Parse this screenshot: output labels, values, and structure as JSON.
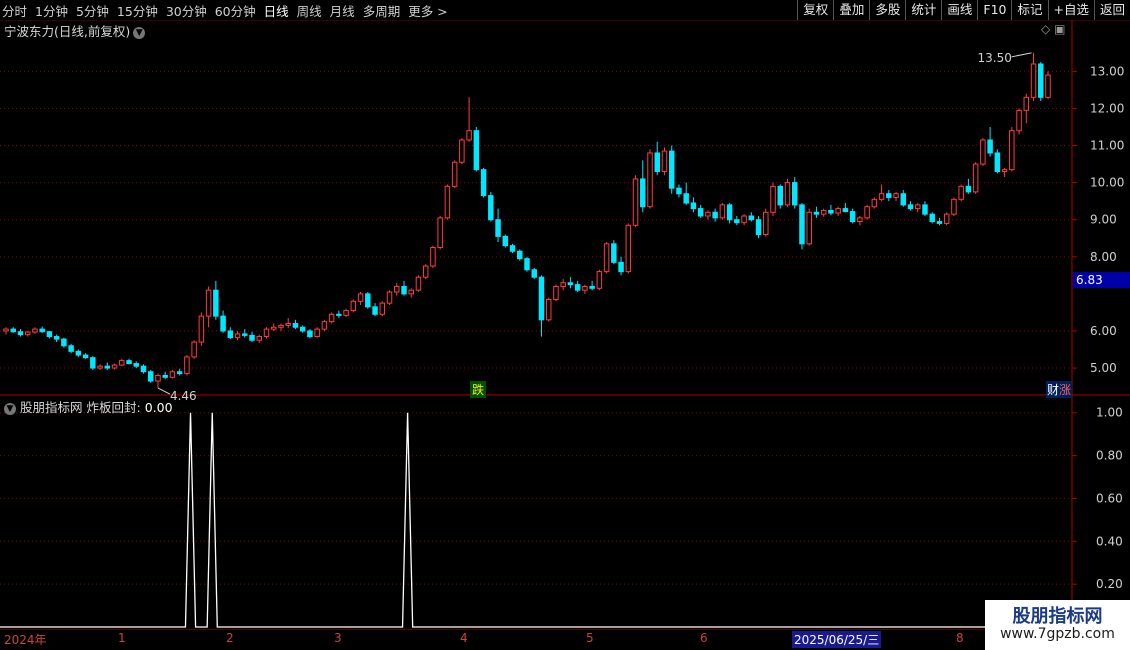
{
  "toolbar": {
    "periods": [
      "分时",
      "1分钟",
      "5分钟",
      "15分钟",
      "30分钟",
      "60分钟",
      "日线",
      "周线",
      "月线",
      "多周期",
      "更多 >"
    ],
    "active_period": "日线",
    "actions": [
      "复权",
      "叠加",
      "多股",
      "统计",
      "画线",
      "F10",
      "标记",
      "+自选",
      "返回"
    ]
  },
  "chart": {
    "title": "宁波东力(日线,前复权)",
    "high_label": "13.50",
    "low_label": "4.46",
    "current_price": "6.83",
    "y_ticks": [
      "13.00",
      "12.00",
      "11.00",
      "10.00",
      "9.00",
      "8.00",
      "6.00",
      "5.00"
    ],
    "tag_die": "跌",
    "tag_cai": "财",
    "tag_zhang": "涨",
    "colors": {
      "up": "#ff3c3c",
      "down": "#00e8ff",
      "grid": "#8a0000",
      "axis": "#b00000"
    }
  },
  "indicator": {
    "name": "股朋指标网",
    "series_label": "炸板回封:",
    "value": "0.00",
    "y_ticks": [
      "1.00",
      "0.80",
      "0.60",
      "0.40",
      "0.20"
    ]
  },
  "date_axis": {
    "labels": [
      "2024年",
      "1",
      "2",
      "3",
      "4",
      "5",
      "6",
      "2025/06/25/三",
      "8"
    ]
  },
  "watermark": {
    "line1": "股朋指标网",
    "line2": "www.7gpzb.com"
  },
  "chart_data": {
    "type": "candlestick",
    "ylim": [
      4.3,
      13.9
    ],
    "candles": [
      [
        6.0,
        6.1,
        5.9,
        6.05
      ],
      [
        6.05,
        6.1,
        5.95,
        5.98
      ],
      [
        5.98,
        6.05,
        5.85,
        5.9
      ],
      [
        5.9,
        6.0,
        5.85,
        5.97
      ],
      [
        5.97,
        6.1,
        5.92,
        6.05
      ],
      [
        6.05,
        6.12,
        5.95,
        5.98
      ],
      [
        5.98,
        6.0,
        5.8,
        5.85
      ],
      [
        5.85,
        5.9,
        5.7,
        5.78
      ],
      [
        5.78,
        5.82,
        5.55,
        5.6
      ],
      [
        5.6,
        5.65,
        5.4,
        5.45
      ],
      [
        5.45,
        5.5,
        5.3,
        5.35
      ],
      [
        5.35,
        5.4,
        5.25,
        5.28
      ],
      [
        5.28,
        5.32,
        4.95,
        5.0
      ],
      [
        5.0,
        5.1,
        4.95,
        5.05
      ],
      [
        5.05,
        5.15,
        4.95,
        5.0
      ],
      [
        5.0,
        5.12,
        4.96,
        5.08
      ],
      [
        5.08,
        5.25,
        5.05,
        5.2
      ],
      [
        5.2,
        5.25,
        5.1,
        5.12
      ],
      [
        5.12,
        5.18,
        5.0,
        5.05
      ],
      [
        5.05,
        5.1,
        4.85,
        4.9
      ],
      [
        4.9,
        4.95,
        4.6,
        4.65
      ],
      [
        4.65,
        4.85,
        4.46,
        4.8
      ],
      [
        4.8,
        4.9,
        4.7,
        4.75
      ],
      [
        4.75,
        4.95,
        4.72,
        4.9
      ],
      [
        4.9,
        4.98,
        4.8,
        4.85
      ],
      [
        4.85,
        5.35,
        4.8,
        5.3
      ],
      [
        5.3,
        5.75,
        5.25,
        5.7
      ],
      [
        5.7,
        6.5,
        5.6,
        6.4
      ],
      [
        6.4,
        7.2,
        6.1,
        7.1
      ],
      [
        7.1,
        7.35,
        6.3,
        6.4
      ],
      [
        6.4,
        6.55,
        5.95,
        6.0
      ],
      [
        6.0,
        6.1,
        5.78,
        5.82
      ],
      [
        5.82,
        6.0,
        5.75,
        5.92
      ],
      [
        5.92,
        6.05,
        5.82,
        5.88
      ],
      [
        5.88,
        5.98,
        5.7,
        5.75
      ],
      [
        5.75,
        5.9,
        5.68,
        5.85
      ],
      [
        5.85,
        6.1,
        5.8,
        6.05
      ],
      [
        6.05,
        6.2,
        6.0,
        6.1
      ],
      [
        6.1,
        6.2,
        6.0,
        6.15
      ],
      [
        6.15,
        6.35,
        6.08,
        6.2
      ],
      [
        6.2,
        6.3,
        6.05,
        6.1
      ],
      [
        6.1,
        6.15,
        5.95,
        6.0
      ],
      [
        6.0,
        6.05,
        5.8,
        5.85
      ],
      [
        5.85,
        6.1,
        5.82,
        6.05
      ],
      [
        6.05,
        6.3,
        6.0,
        6.25
      ],
      [
        6.25,
        6.5,
        6.2,
        6.45
      ],
      [
        6.45,
        6.55,
        6.35,
        6.42
      ],
      [
        6.42,
        6.6,
        6.38,
        6.55
      ],
      [
        6.55,
        6.85,
        6.5,
        6.8
      ],
      [
        6.8,
        7.05,
        6.7,
        7.0
      ],
      [
        7.0,
        7.05,
        6.6,
        6.65
      ],
      [
        6.65,
        6.75,
        6.4,
        6.45
      ],
      [
        6.45,
        6.8,
        6.4,
        6.75
      ],
      [
        6.75,
        7.1,
        6.7,
        7.05
      ],
      [
        7.05,
        7.3,
        6.95,
        7.2
      ],
      [
        7.2,
        7.35,
        6.95,
        7.0
      ],
      [
        7.0,
        7.15,
        6.9,
        7.1
      ],
      [
        7.1,
        7.5,
        7.05,
        7.45
      ],
      [
        7.45,
        7.8,
        7.4,
        7.75
      ],
      [
        7.75,
        8.3,
        7.7,
        8.25
      ],
      [
        8.25,
        9.1,
        8.2,
        9.05
      ],
      [
        9.05,
        9.95,
        9.0,
        9.9
      ],
      [
        9.9,
        10.6,
        9.85,
        10.55
      ],
      [
        10.55,
        11.2,
        10.5,
        11.15
      ],
      [
        11.15,
        12.3,
        11.1,
        11.4
      ],
      [
        11.4,
        11.5,
        10.3,
        10.35
      ],
      [
        10.35,
        10.4,
        9.6,
        9.65
      ],
      [
        9.65,
        9.75,
        8.95,
        9.0
      ],
      [
        9.0,
        9.3,
        8.4,
        8.55
      ],
      [
        8.55,
        8.6,
        8.25,
        8.3
      ],
      [
        8.3,
        8.35,
        8.1,
        8.15
      ],
      [
        8.15,
        8.2,
        7.9,
        7.95
      ],
      [
        7.95,
        8.0,
        7.6,
        7.65
      ],
      [
        7.65,
        7.7,
        7.4,
        7.45
      ],
      [
        7.45,
        7.5,
        5.85,
        6.3
      ],
      [
        6.3,
        6.9,
        6.25,
        6.85
      ],
      [
        6.85,
        7.25,
        6.8,
        7.2
      ],
      [
        7.2,
        7.4,
        7.1,
        7.3
      ],
      [
        7.3,
        7.45,
        7.15,
        7.25
      ],
      [
        7.25,
        7.35,
        7.05,
        7.1
      ],
      [
        7.1,
        7.25,
        7.0,
        7.2
      ],
      [
        7.2,
        7.35,
        7.1,
        7.15
      ],
      [
        7.15,
        7.65,
        7.1,
        7.6
      ],
      [
        7.6,
        8.4,
        7.55,
        8.35
      ],
      [
        8.35,
        8.45,
        7.8,
        7.85
      ],
      [
        7.85,
        8.0,
        7.5,
        7.6
      ],
      [
        7.6,
        8.9,
        7.55,
        8.85
      ],
      [
        8.85,
        10.2,
        8.8,
        10.1
      ],
      [
        10.1,
        10.6,
        9.2,
        9.35
      ],
      [
        9.35,
        10.9,
        9.3,
        10.8
      ],
      [
        10.8,
        11.1,
        10.2,
        10.3
      ],
      [
        10.3,
        10.95,
        10.2,
        10.85
      ],
      [
        10.85,
        11.0,
        9.7,
        9.85
      ],
      [
        9.85,
        9.95,
        9.6,
        9.7
      ],
      [
        9.7,
        10.0,
        9.4,
        9.45
      ],
      [
        9.45,
        9.6,
        9.2,
        9.3
      ],
      [
        9.3,
        9.4,
        9.05,
        9.1
      ],
      [
        9.1,
        9.25,
        9.0,
        9.2
      ],
      [
        9.2,
        9.3,
        8.95,
        9.05
      ],
      [
        9.05,
        9.45,
        9.0,
        9.4
      ],
      [
        9.4,
        9.45,
        8.9,
        9.0
      ],
      [
        9.0,
        9.1,
        8.85,
        8.92
      ],
      [
        8.92,
        9.15,
        8.85,
        9.1
      ],
      [
        9.1,
        9.2,
        8.95,
        9.0
      ],
      [
        9.0,
        9.1,
        8.5,
        8.6
      ],
      [
        8.6,
        9.3,
        8.55,
        9.2
      ],
      [
        9.2,
        10.0,
        9.1,
        9.9
      ],
      [
        9.9,
        9.95,
        9.3,
        9.4
      ],
      [
        9.4,
        10.1,
        9.35,
        10.0
      ],
      [
        10.0,
        10.15,
        9.3,
        9.4
      ],
      [
        9.4,
        9.45,
        8.2,
        8.35
      ],
      [
        8.35,
        9.3,
        8.3,
        9.2
      ],
      [
        9.2,
        9.35,
        9.05,
        9.15
      ],
      [
        9.15,
        9.3,
        9.08,
        9.25
      ],
      [
        9.25,
        9.4,
        9.12,
        9.18
      ],
      [
        9.18,
        9.35,
        9.1,
        9.3
      ],
      [
        9.3,
        9.45,
        9.2,
        9.22
      ],
      [
        9.22,
        9.3,
        8.9,
        8.95
      ],
      [
        8.95,
        9.1,
        8.85,
        9.05
      ],
      [
        9.05,
        9.4,
        9.0,
        9.35
      ],
      [
        9.35,
        9.6,
        9.3,
        9.55
      ],
      [
        9.55,
        9.95,
        9.5,
        9.7
      ],
      [
        9.7,
        9.8,
        9.5,
        9.6
      ],
      [
        9.6,
        9.75,
        9.5,
        9.7
      ],
      [
        9.7,
        9.8,
        9.35,
        9.4
      ],
      [
        9.4,
        9.5,
        9.25,
        9.3
      ],
      [
        9.3,
        9.45,
        9.2,
        9.4
      ],
      [
        9.4,
        9.5,
        9.1,
        9.15
      ],
      [
        9.15,
        9.2,
        8.9,
        8.95
      ],
      [
        8.95,
        9.05,
        8.85,
        8.9
      ],
      [
        8.9,
        9.2,
        8.85,
        9.15
      ],
      [
        9.15,
        9.6,
        9.1,
        9.55
      ],
      [
        9.55,
        9.95,
        9.5,
        9.9
      ],
      [
        9.9,
        10.1,
        9.7,
        9.75
      ],
      [
        9.75,
        10.55,
        9.7,
        10.5
      ],
      [
        10.5,
        11.2,
        10.45,
        11.15
      ],
      [
        11.15,
        11.5,
        10.7,
        10.8
      ],
      [
        10.8,
        10.9,
        10.25,
        10.3
      ],
      [
        10.3,
        10.4,
        10.15,
        10.35
      ],
      [
        10.35,
        11.5,
        10.3,
        11.4
      ],
      [
        11.4,
        12.0,
        11.3,
        11.95
      ],
      [
        11.95,
        12.4,
        11.6,
        12.3
      ],
      [
        12.3,
        13.5,
        12.2,
        13.2
      ],
      [
        13.2,
        13.25,
        12.2,
        12.3
      ],
      [
        12.3,
        13.0,
        12.25,
        12.9
      ]
    ],
    "indicator_series": {
      "name": "炸板回封",
      "spikes": [
        {
          "index": 25,
          "value": 1.0
        },
        {
          "index": 28,
          "value": 1.0
        },
        {
          "index": 55,
          "value": 1.0
        }
      ],
      "ylim": [
        0,
        1.05
      ]
    }
  }
}
